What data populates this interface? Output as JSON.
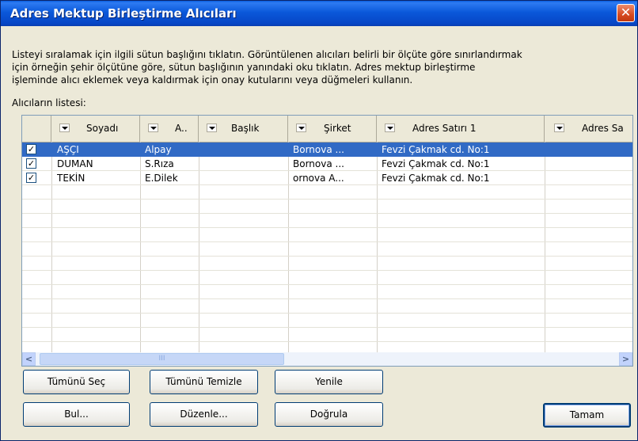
{
  "window": {
    "title": "Adres Mektup Birleştirme Alıcıları",
    "close_symbol": "✕"
  },
  "description_lines": [
    "Listeyi sıralamak için ilgili sütun başlığını tıklatın. Görüntülenen alıcıları belirli bir ölçüte göre sınırlandırmak",
    "için örneğin şehir ölçütüne göre, sütun başlığının yanındaki oku tıklatın. Adres mektup birleştirme",
    "işleminde alıcı eklemek veya kaldırmak için onay kutularını veya düğmeleri kullanın."
  ],
  "list_label": "Alıcıların listesi:",
  "columns": [
    "Soyadı",
    "A..",
    "Başlık",
    "Şirket",
    "Adres Satırı 1",
    "Adres Sa"
  ],
  "rows": [
    {
      "checked": "✓",
      "cells": [
        "AŞÇI",
        "Alpay",
        "",
        "Bornova ...",
        "Fevzi Çakmak cd. No:1"
      ],
      "selected": true
    },
    {
      "checked": "✓",
      "cells": [
        "DUMAN",
        "S.Rıza",
        "",
        "Bornova ...",
        "Fevzi Çakmak cd. No:1"
      ],
      "selected": false
    },
    {
      "checked": "✓",
      "cells": [
        "TEKİN",
        "E.Dilek",
        "",
        "ornova A...",
        "Fevzi Çakmak cd. No:1"
      ],
      "selected": false
    }
  ],
  "scrollbar": {
    "left_arrow": "<",
    "right_arrow": ">",
    "grip": "III"
  },
  "buttons": {
    "select_all": "Tümünü Seç",
    "clear_all": "Tümünü Temizle",
    "refresh": "Yenile",
    "find": "Bul...",
    "edit": "Düzenle...",
    "validate": "Doğrula",
    "ok": "Tamam"
  },
  "colors": {
    "titlebar": "#0A58DA",
    "selection": "#316AC5",
    "dialog": "#ECE9D8"
  }
}
